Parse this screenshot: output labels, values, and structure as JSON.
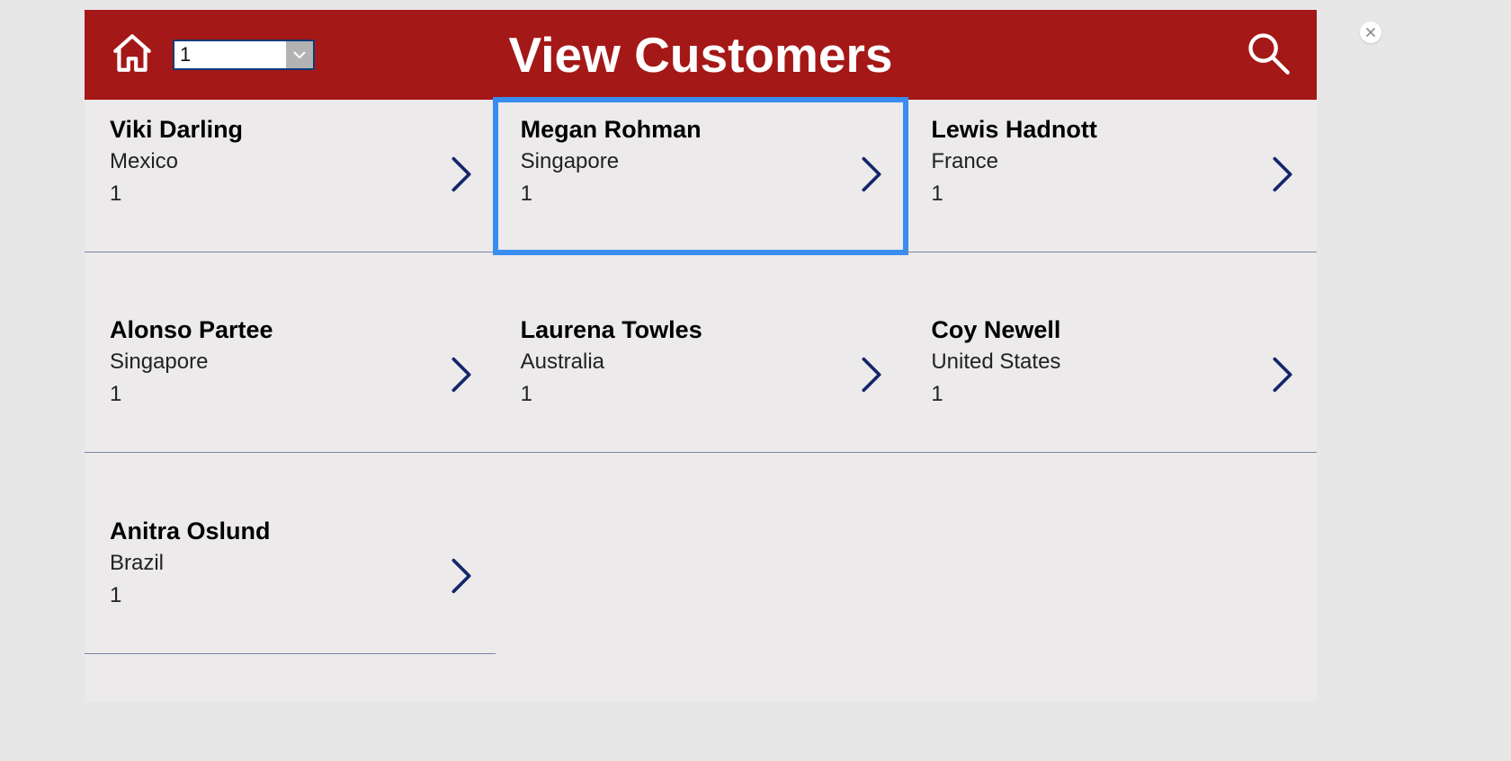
{
  "header": {
    "title": "View Customers",
    "dropdown_value": "1"
  },
  "customers": [
    {
      "name": "Viki  Darling",
      "country": "Mexico",
      "num": "1",
      "selected": false
    },
    {
      "name": "Megan  Rohman",
      "country": "Singapore",
      "num": "1",
      "selected": true
    },
    {
      "name": "Lewis  Hadnott",
      "country": "France",
      "num": "1",
      "selected": false
    },
    {
      "name": "Alonso  Partee",
      "country": "Singapore",
      "num": "1",
      "selected": false
    },
    {
      "name": "Laurena  Towles",
      "country": "Australia",
      "num": "1",
      "selected": false
    },
    {
      "name": "Coy  Newell",
      "country": "United States",
      "num": "1",
      "selected": false
    },
    {
      "name": "Anitra  Oslund",
      "country": "Brazil",
      "num": "1",
      "selected": false
    }
  ]
}
